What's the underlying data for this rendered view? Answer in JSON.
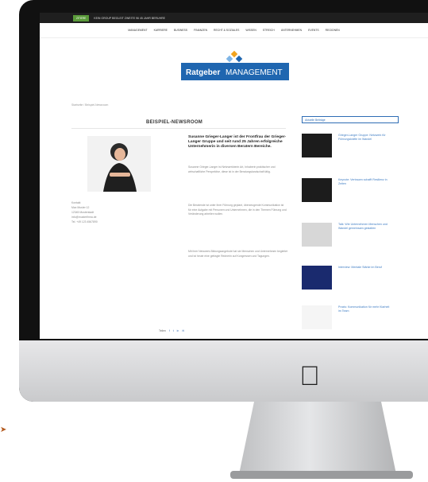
{
  "topbar": {
    "badge": "ZITIERE",
    "ticker": "KEIN GROUP BEGLEIT ZWEITE 96 45 JAHR BERUHRE"
  },
  "nav": [
    "MANAGEMENT",
    "KARRIERE",
    "BUSINESS",
    "FINANZEN",
    "RECHT & SOZIALES",
    "WISSEN",
    "STREICH",
    "UNTERNEHMEN",
    "EVENTS",
    "REGIONEN"
  ],
  "logo": {
    "word1": "Ratgeber",
    "word2": "MANAGEMENT",
    "color_blue": "#1f66b0"
  },
  "breadcrumb": "Startseite / Beispiel-Newsroom",
  "article": {
    "title": "BEISPIEL-NEWSROOM",
    "headline": "Susanne Grieger-Langer ist der Frontfrau der Grieger-Langer Gruppe und seit rund 25 Jahren erfolgreiche Unternehmerin in diversen Beratern Bereiche.",
    "paragraphs": [
      "Susanne Grieger-Langer ist Netzwerkberin Art, Inhaberin praktischer und wirtschaftliche Perspektive, diese ist in der Beratungslandschaft tätig.",
      "Die Beratende ist unter ihrer Führung geplant, überzeugende Kommunikation ist für eine Aufgabe mit Personen und Unternehmen, die in den Themen Führung und Veränderung arbeiten wollen.",
      "Mit ihrer Netzwerk-Bildungsangebote hat sie Menschen und Unternehmen begleitet und ist heute eine gefragte Rednerin auf Kongressen und Tagungen."
    ],
    "contact": [
      "Kontakt",
      "Max Muster 12",
      "12345 Musterstadt",
      "info@musterfirma.de",
      "Tel. +49 123 4567890"
    ],
    "share_label": "Teilen"
  },
  "sidebar": {
    "search_label": "Aktuelle Beiträge",
    "items": [
      "Grieger-Langer Gruppe: Netzwerk für Führungskräfte im Wandel",
      "Keynote: Vertrauen schafft Resilienz in Zeiten",
      "Talk: Wie Unternehmen Menschen und Wandel gemeinsam gestalten",
      "Interview: Mentale Stärke im Beruf",
      "Praxis: Kommunikation für mehr Klarheit im Team"
    ]
  },
  "colors": {
    "accent": "#2f6db5",
    "badge": "#5a9a3a",
    "topbar": "#1f1f1f"
  }
}
